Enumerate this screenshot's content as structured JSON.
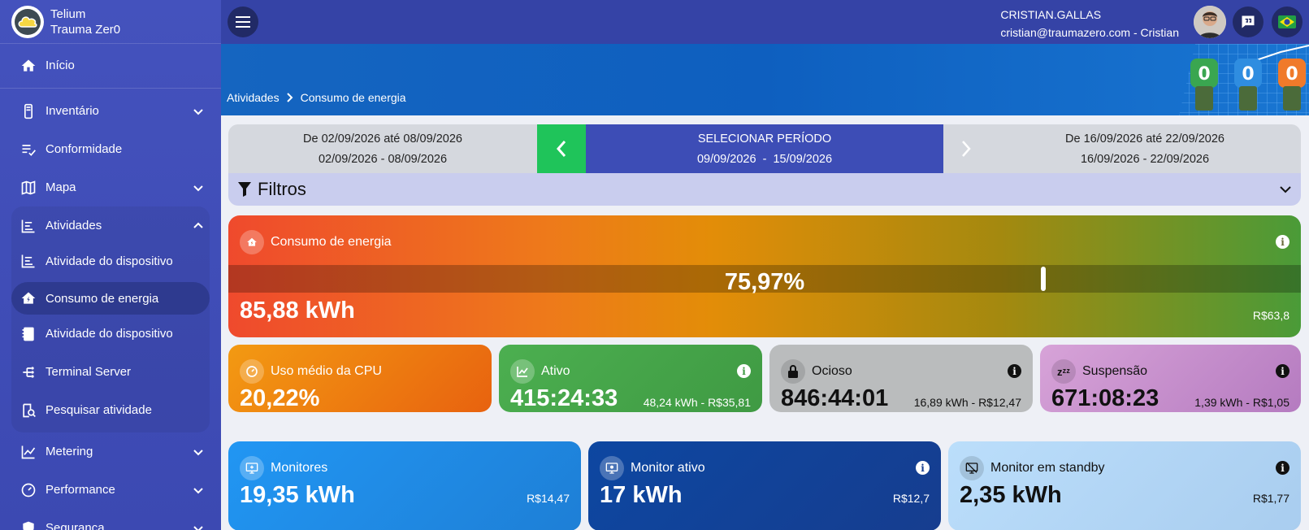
{
  "brand": {
    "line1": "Telium",
    "line2": "Trauma Zer0"
  },
  "sidebar": {
    "items": [
      {
        "label": "Início",
        "icon": "home-icon"
      },
      {
        "label": "Inventário",
        "icon": "device-icon"
      },
      {
        "label": "Conformidade",
        "icon": "checklist-icon"
      },
      {
        "label": "Mapa",
        "icon": "map-icon"
      },
      {
        "label": "Atividades",
        "icon": "timeline-icon"
      },
      {
        "label": "Metering",
        "icon": "chart-line-icon"
      },
      {
        "label": "Performance",
        "icon": "gauge-icon"
      },
      {
        "label": "Segurança",
        "icon": "shield-icon"
      }
    ],
    "sub_items": [
      {
        "label": "Atividade do dispositivo",
        "icon": "timeline-icon"
      },
      {
        "label": "Consumo de energia",
        "icon": "energy-house-icon"
      },
      {
        "label": "Atividade do dispositivo",
        "icon": "notebook-icon"
      },
      {
        "label": "Terminal Server",
        "icon": "network-icon"
      },
      {
        "label": "Pesquisar atividade",
        "icon": "search-doc-icon"
      }
    ]
  },
  "user": {
    "name": "CRISTIAN.GALLAS",
    "email_line": "cristian@traumazero.com - Cristian"
  },
  "breadcrumb": {
    "parent": "Atividades",
    "current": "Consumo de energia"
  },
  "period": {
    "prev_title": "De 02/09/2026 até 08/09/2026",
    "prev_range": "02/09/2026 - 08/09/2026",
    "current_title": "SELECIONAR PERÍODO",
    "current_range": "09/09/2026  -  15/09/2026",
    "next_title": "De 16/09/2026 até 22/09/2026",
    "next_range": "16/09/2026 - 22/09/2026"
  },
  "filters": {
    "label": "Filtros"
  },
  "energy": {
    "title": "Consumo de energia",
    "percent_label": "75,97%",
    "percent_value": 75.97,
    "value": "85,88 kWh",
    "cost": "R$63,8"
  },
  "cards": {
    "cpu": {
      "title": "Uso médio da CPU",
      "value": "20,22%"
    },
    "ativo": {
      "title": "Ativo",
      "value": "415:24:33",
      "detail": "48,24 kWh - R$35,81"
    },
    "ocioso": {
      "title": "Ocioso",
      "value": "846:44:01",
      "detail": "16,89 kWh - R$12,47"
    },
    "suspensao": {
      "title": "Suspensão",
      "value": "671:08:23",
      "detail": "1,39 kWh - R$1,05",
      "icon_text": "zᶻᶻ"
    },
    "monitores": {
      "title": "Monitores",
      "value": "19,35 kWh",
      "cost": "R$14,47"
    },
    "monitor_ativo": {
      "title": "Monitor ativo",
      "value": "17 kWh",
      "cost": "R$12,7"
    },
    "monitor_standby": {
      "title": "Monitor em standby",
      "value": "2,35 kWh",
      "cost": "R$1,77"
    }
  },
  "info_glyph": "i",
  "colors": {
    "sidebar": "#4452bd",
    "topbar": "#3543a6",
    "accent_green": "#1fc45a",
    "period_mid": "#3d4db6"
  }
}
